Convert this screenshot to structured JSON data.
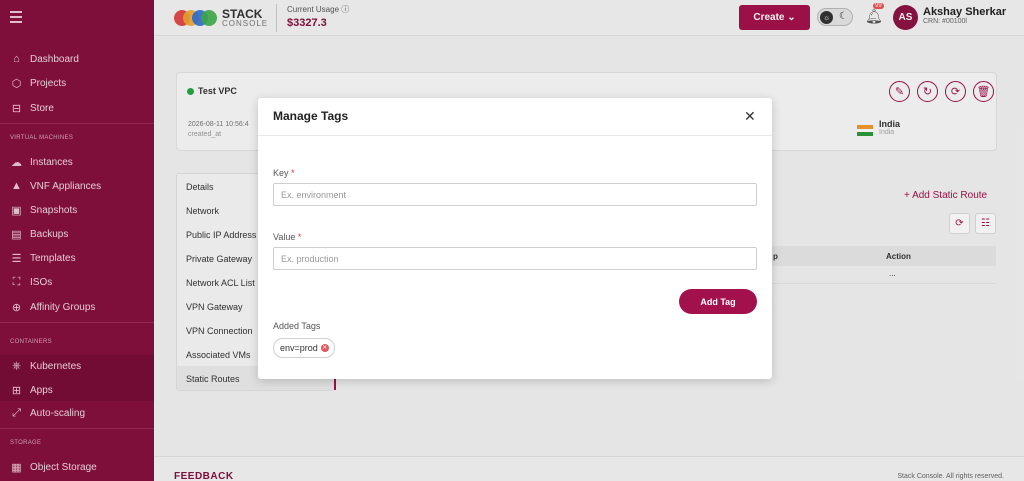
{
  "sidebar": {
    "items": [
      {
        "label": "Dashboard",
        "icon": "home-icon"
      },
      {
        "label": "Projects",
        "icon": "box-icon"
      },
      {
        "label": "Store",
        "icon": "cart-icon"
      },
      {
        "label": "Instances",
        "icon": "cloud-icon"
      },
      {
        "label": "VNF Appliances",
        "icon": "vnf-icon"
      },
      {
        "label": "Snapshots",
        "icon": "snapshot-icon"
      },
      {
        "label": "Backups",
        "icon": "backup-icon"
      },
      {
        "label": "Templates",
        "icon": "template-icon"
      },
      {
        "label": "ISOs",
        "icon": "iso-icon"
      },
      {
        "label": "Affinity Groups",
        "icon": "affinity-icon"
      },
      {
        "label": "Kubernetes",
        "icon": "kubernetes-icon"
      },
      {
        "label": "Apps",
        "icon": "apps-icon"
      },
      {
        "label": "Auto-scaling",
        "icon": "autoscale-icon"
      },
      {
        "label": "Object Storage",
        "icon": "storage-icon"
      }
    ],
    "sections": {
      "virtual_machines": "VIRTUAL MACHINES",
      "containers": "CONTAINERS",
      "storage": "STORAGE"
    }
  },
  "header": {
    "logo_line1": "STACK",
    "logo_line2": "CONSOLE",
    "usage_label": "Current Usage",
    "usage_value": "$3327.3",
    "create_label": "Create",
    "notification_count": "99",
    "avatar_initials": "AS",
    "user_name": "Akshay Sherkar",
    "user_crn": "CRN: #00100l"
  },
  "vpc": {
    "name": "Test VPC",
    "created_value": "2026-08-11 10:56:4",
    "created_label": "created_at",
    "region_name": "India",
    "region_sub": "India"
  },
  "detail_menu": [
    "Details",
    "Network",
    "Public IP Address",
    "Private Gateway",
    "Network ACL List",
    "VPN Gateway",
    "VPN Connection",
    "Associated VMs",
    "Static Routes"
  ],
  "routes": {
    "add_label": "+ Add Static Route",
    "col_partial": "p",
    "col_action": "Action",
    "row_action": "..."
  },
  "footer": {
    "feedback": "FEEDBACK",
    "copyright": "Stack Console. All rights reserved."
  },
  "modal": {
    "title": "Manage Tags",
    "key_label": "Key",
    "key_placeholder": "Ex. environment",
    "value_label": "Value",
    "value_placeholder": "Ex. production",
    "required_mark": "*",
    "add_button": "Add Tag",
    "added_tags_label": "Added Tags",
    "tags": [
      "env=prod"
    ]
  },
  "colors": {
    "brand": "#86103f",
    "accent": "#a3114c",
    "status_green": "#22a845"
  }
}
